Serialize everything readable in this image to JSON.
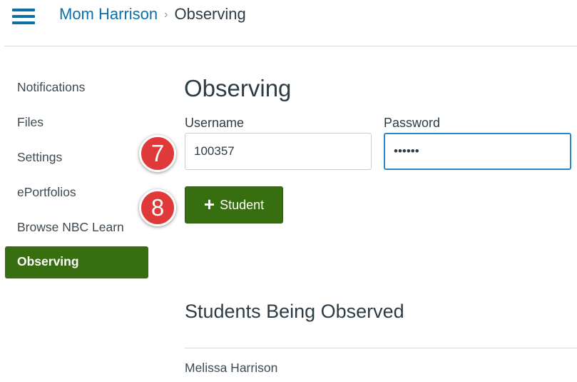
{
  "header": {
    "menu_icon": "hamburger-menu-icon",
    "breadcrumb": {
      "parent": "Mom Harrison",
      "separator": "›",
      "current": "Observing"
    },
    "accent_color": "#0c6fa8"
  },
  "sidebar": {
    "items": [
      {
        "label": "Notifications",
        "active": false
      },
      {
        "label": "Files",
        "active": false
      },
      {
        "label": "Settings",
        "active": false
      },
      {
        "label": "ePortfolios",
        "active": false
      },
      {
        "label": "Browse NBC Learn",
        "active": false
      },
      {
        "label": "Observing",
        "active": true
      }
    ],
    "active_color": "#376e10"
  },
  "main": {
    "title": "Observing",
    "username": {
      "label": "Username",
      "value": "100357"
    },
    "password": {
      "label": "Password",
      "value": "••••••"
    },
    "add_button": {
      "icon": "plus-icon",
      "label": "Student"
    },
    "students_heading": "Students Being Observed",
    "students": [
      "Melissa Harrison"
    ]
  },
  "callouts": [
    {
      "number": "7",
      "color": "#e0393a"
    },
    {
      "number": "8",
      "color": "#e0393a"
    }
  ]
}
